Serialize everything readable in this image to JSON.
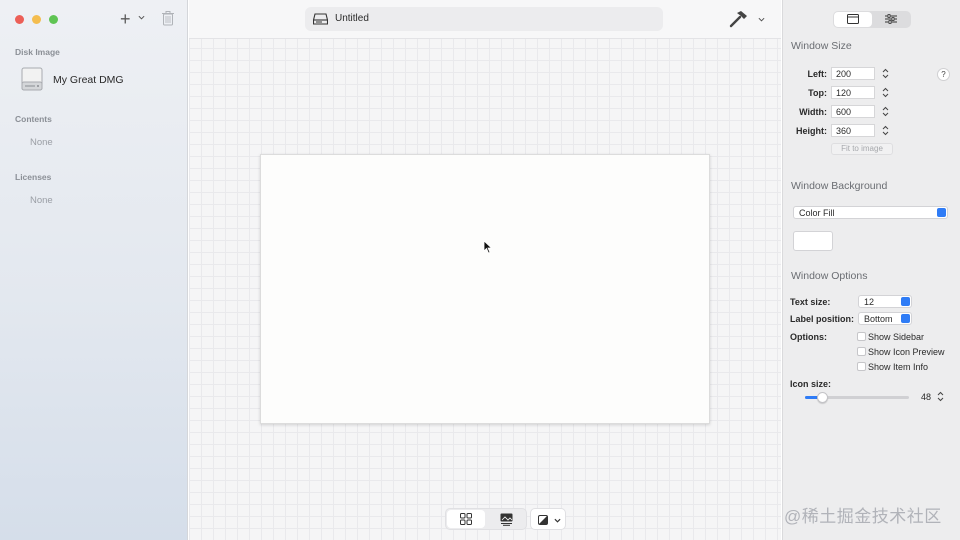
{
  "sidebar": {
    "sections": {
      "disk_image": "Disk Image",
      "contents": "Contents",
      "licenses": "Licenses"
    },
    "disk_name": "My Great DMG",
    "contents_empty": "None",
    "licenses_empty": "None",
    "add_label": "+",
    "icons": [
      "hard-drive-icon",
      "trash-icon",
      "plus-icon",
      "chevron-down-icon"
    ]
  },
  "toolbar": {
    "title": "Untitled",
    "icons": [
      "disk-icon",
      "hammer-icon",
      "chevron-down-icon"
    ]
  },
  "bottom_bar": {
    "icons": [
      "grid-view-icon",
      "image-view-icon",
      "appearance-icon",
      "chevron-down-icon"
    ]
  },
  "inspector": {
    "tabs_icons": [
      "window-icon",
      "sliders-icon"
    ],
    "window_size": {
      "heading": "Window Size",
      "left_label": "Left:",
      "left_value": "200",
      "top_label": "Top:",
      "top_value": "120",
      "width_label": "Width:",
      "width_value": "600",
      "height_label": "Height:",
      "height_value": "360",
      "help": "?",
      "fit_button": "Fit to image"
    },
    "window_background": {
      "heading": "Window Background",
      "fill_type": "Color Fill",
      "swatch_color": "#ffffff"
    },
    "window_options": {
      "heading": "Window Options",
      "text_size_label": "Text size:",
      "text_size_value": "12",
      "label_position_label": "Label position:",
      "label_position_value": "Bottom",
      "options_label": "Options:",
      "show_sidebar": "Show Sidebar",
      "show_icon_preview": "Show Icon Preview",
      "show_item_info": "Show Item Info",
      "icon_size_label": "Icon size:",
      "icon_size_value": "48",
      "icon_size_fraction": 0.16
    }
  },
  "watermark": "@稀土掘金技术社区",
  "colors": {
    "accent": "#2f7cf6",
    "close": "#ec5f57",
    "minimize": "#f4bd4f",
    "maximize": "#5fc453"
  }
}
